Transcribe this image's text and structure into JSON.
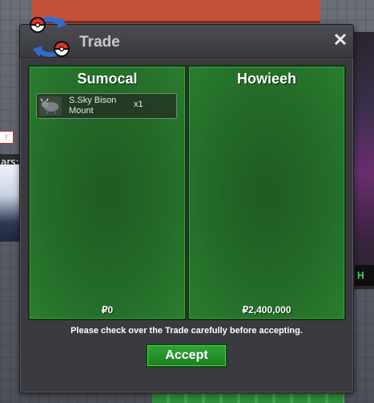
{
  "window": {
    "title": "Trade",
    "close_glyph": "✕"
  },
  "left_party": {
    "name": "Sumocal",
    "money": "₽0",
    "items": [
      {
        "name": "S.Sky Bison Mount",
        "quantity": "x1",
        "icon": "bison-mount-icon"
      }
    ]
  },
  "right_party": {
    "name": "Howieeh",
    "money": "₽2,400,000",
    "items": []
  },
  "notice": "Please check over the Trade carefully before accepting.",
  "actions": {
    "accept_label": "Accept"
  },
  "colors": {
    "panel_green": "#236b28",
    "accept_green": "#2fa535",
    "window_bg": "#3a3a40",
    "title_text": "#c9cad0"
  }
}
